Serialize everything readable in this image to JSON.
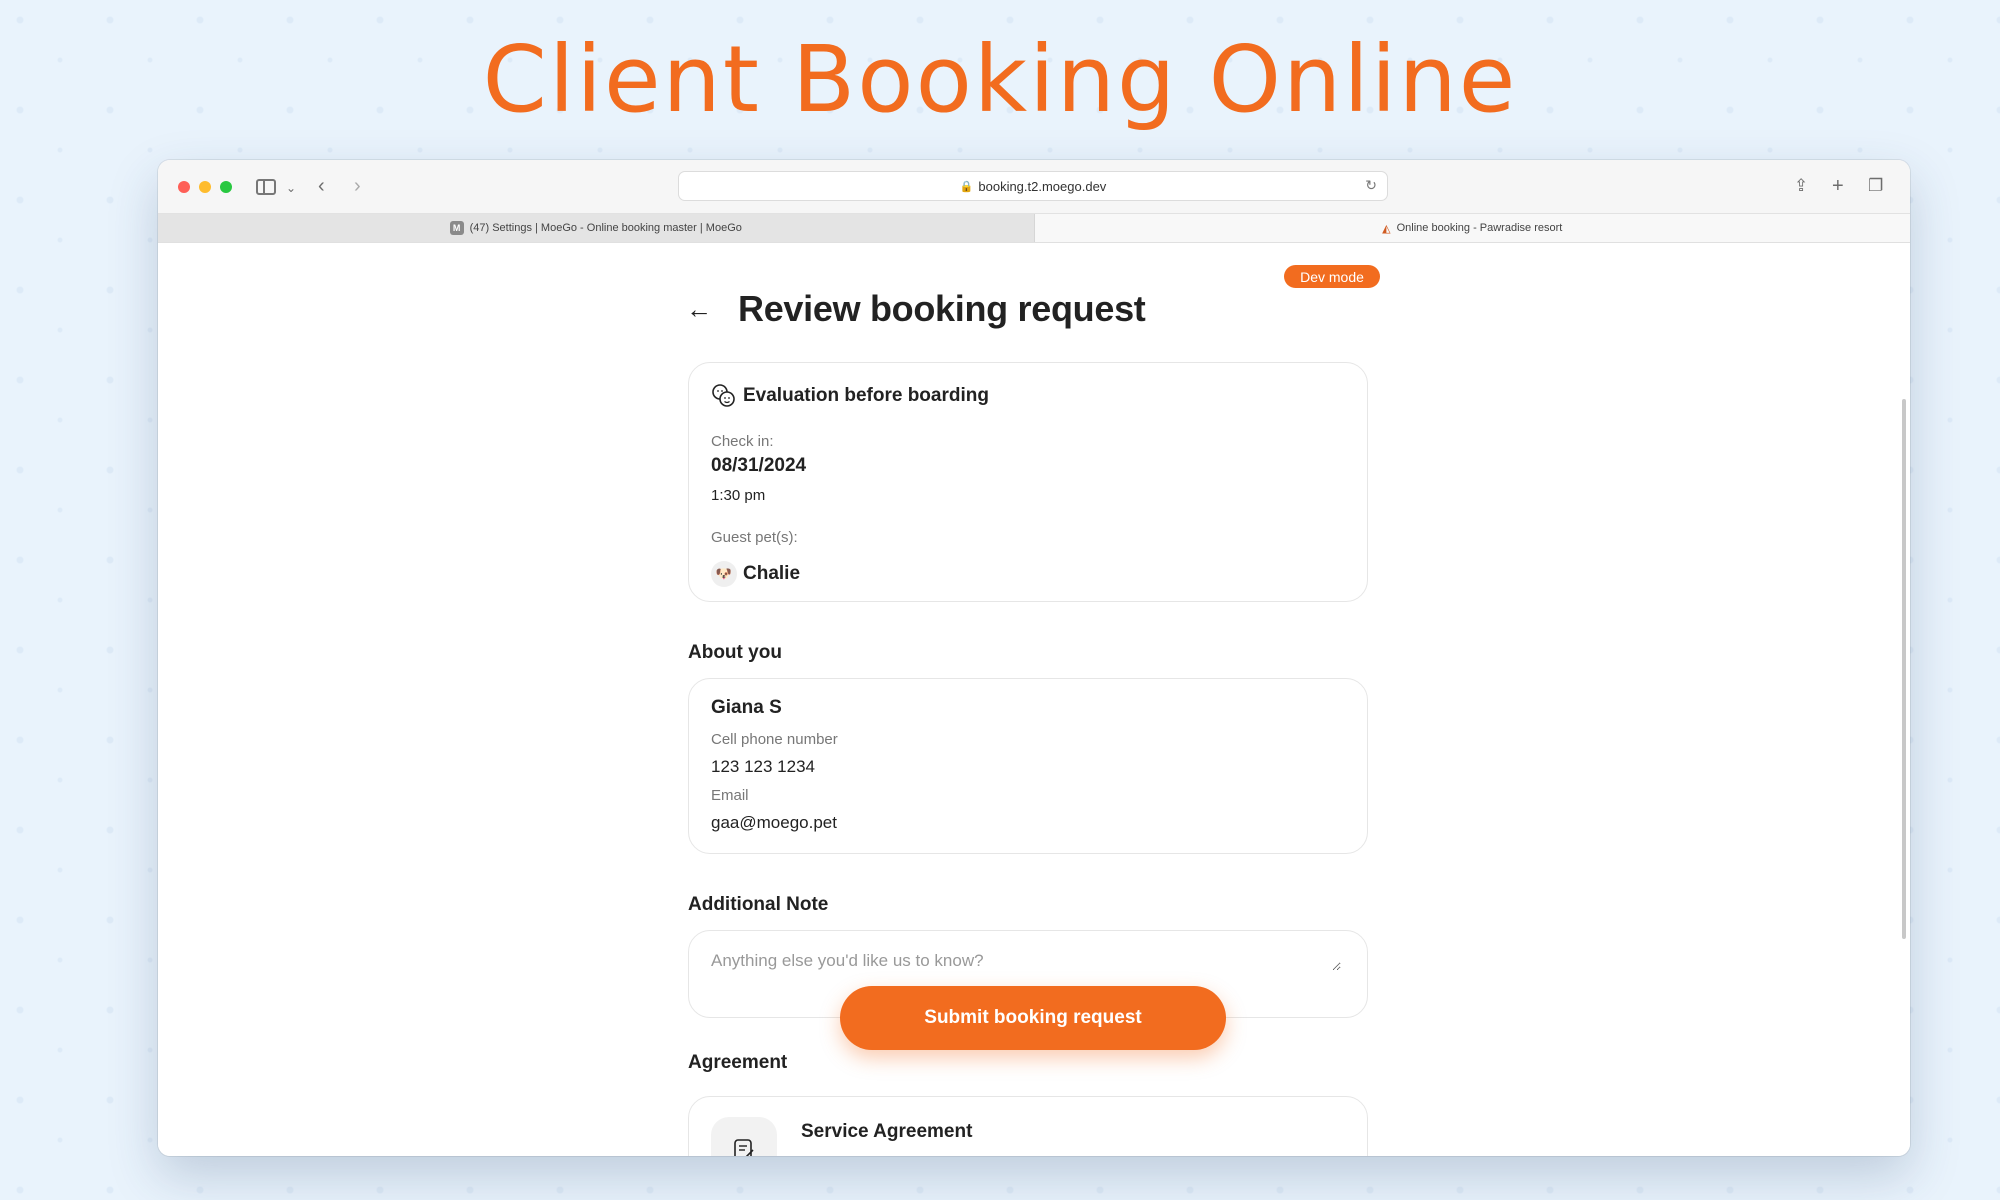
{
  "headline": "Client Booking Online",
  "browser": {
    "url": "booking.t2.moego.dev",
    "tabs": [
      {
        "favicon": "M",
        "label": "(47) Settings | MoeGo - Online booking master | MoeGo"
      },
      {
        "label": "Online booking - Pawradise resort"
      }
    ]
  },
  "page": {
    "dev_badge": "Dev mode",
    "title": "Review booking request",
    "service": {
      "title": "Evaluation before boarding",
      "checkin_label": "Check in:",
      "checkin_date": "08/31/2024",
      "checkin_time": "1:30 pm",
      "pets_label": "Guest pet(s):",
      "pet_name": "Chalie"
    },
    "about": {
      "heading": "About you",
      "name": "Giana S",
      "phone_label": "Cell phone number",
      "phone": "123 123 1234",
      "email_label": "Email",
      "email": "gaa@moego.pet"
    },
    "note": {
      "heading": "Additional Note",
      "placeholder": "Anything else you'd like us to know?",
      "value": ""
    },
    "submit_label": "Submit booking request",
    "agreement": {
      "heading": "Agreement",
      "title": "Service Agreement"
    }
  },
  "colors": {
    "accent": "#f26c1f",
    "background": "#e9f3fc"
  }
}
